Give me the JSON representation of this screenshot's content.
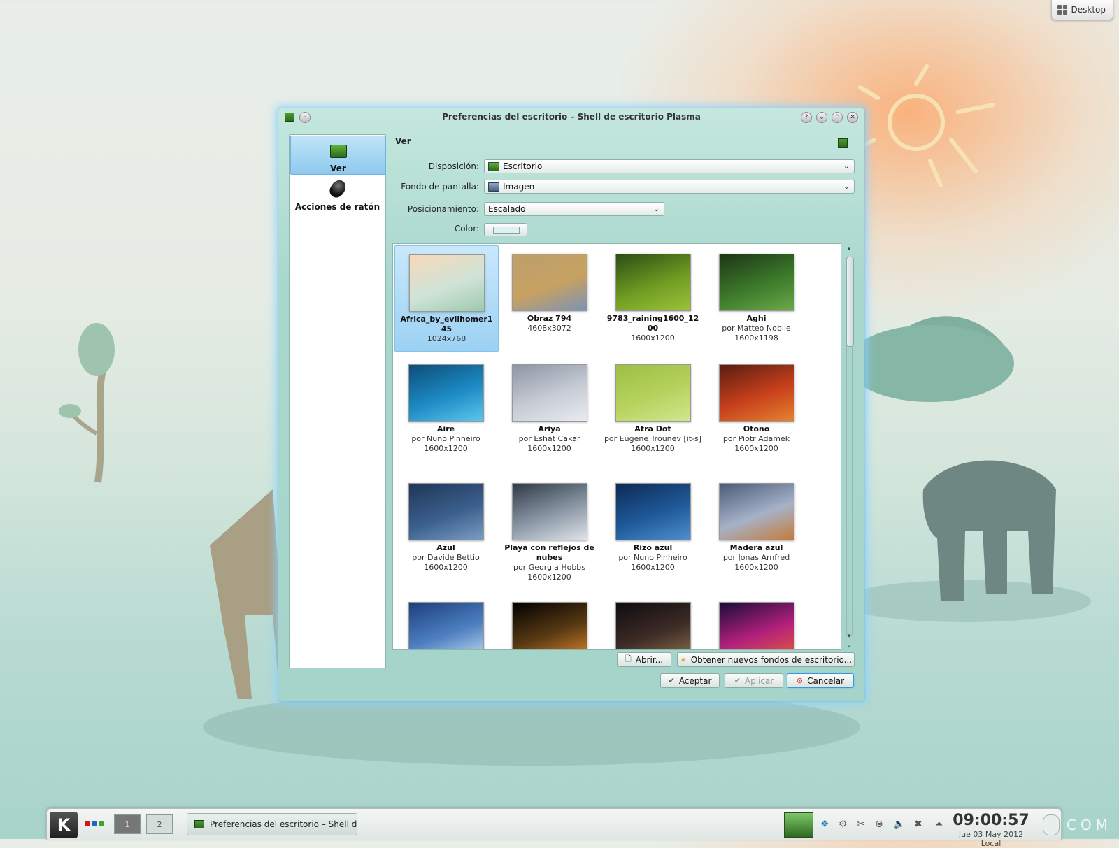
{
  "desktop": {
    "toolbox_label": "Desktop"
  },
  "dialog": {
    "title": "Preferencias del escritorio – Shell de escritorio Plasma",
    "sidebar": [
      {
        "label": "Ver",
        "icon": "display-icon",
        "selected": true
      },
      {
        "label": "Acciones de ratón",
        "icon": "mouse-icon",
        "selected": false
      }
    ],
    "section_title": "Ver",
    "form": {
      "layout_label": "Disposición:",
      "layout_value": "Escritorio",
      "wallpaper_label": "Fondo de pantalla:",
      "wallpaper_value": "Imagen",
      "positioning_label": "Posicionamiento:",
      "positioning_value": "Escalado",
      "color_label": "Color:",
      "color_value": "#dfeff3"
    },
    "wallpapers": [
      {
        "name": "Africa_by_evilhomer1 45",
        "author": "",
        "size": "1024x768",
        "selected": true,
        "colors": [
          "#f6d9b8",
          "#cfe3d7",
          "#9dc9ad"
        ]
      },
      {
        "name": "Obraz 794",
        "author": "",
        "size": "4608x3072",
        "colors": [
          "#bda06c",
          "#c7a162",
          "#7b93b4"
        ]
      },
      {
        "name": "9783_raining1600_12 00",
        "author": "",
        "size": "1600x1200",
        "colors": [
          "#2d4d13",
          "#6f9c22",
          "#9cc23b"
        ]
      },
      {
        "name": "Aghi",
        "author": "por Matteo Nobile",
        "size": "1600x1198",
        "colors": [
          "#1d3518",
          "#3d7a2a",
          "#6ca84b"
        ]
      },
      {
        "name": "Aire",
        "author": "por Nuno Pinheiro",
        "size": "1600x1200",
        "colors": [
          "#0c4d78",
          "#1d8bc4",
          "#5ac6ee"
        ]
      },
      {
        "name": "Ariya",
        "author": "por Eshat Cakar",
        "size": "1600x1200",
        "colors": [
          "#8d95a3",
          "#c7ccd5",
          "#e8ebf0"
        ]
      },
      {
        "name": "Atra Dot",
        "author": "por Eugene Trounev [it-s]",
        "size": "1600x1200",
        "colors": [
          "#9bbf43",
          "#b7d35e",
          "#d1e690"
        ]
      },
      {
        "name": "Otoño",
        "author": "por Piotr Adamek",
        "size": "1600x1200",
        "colors": [
          "#5a1d10",
          "#c8401c",
          "#e4832f"
        ]
      },
      {
        "name": "Azul",
        "author": "por Davide Bettio",
        "size": "1600x1200",
        "colors": [
          "#1f3658",
          "#3b5f8c",
          "#7a9cc4"
        ]
      },
      {
        "name": "Playa con reflejos de nubes",
        "author": "por Georgia Hobbs",
        "size": "1600x1200",
        "colors": [
          "#2f3a46",
          "#8b98a6",
          "#dfe3e8"
        ]
      },
      {
        "name": "Rizo azul",
        "author": "por Nuno Pinheiro",
        "size": "1600x1200",
        "colors": [
          "#0d2a55",
          "#1f5a9a",
          "#4f8fcf"
        ]
      },
      {
        "name": "Madera azul",
        "author": "por Jonas Arnfred",
        "size": "1600x1200",
        "colors": [
          "#4b5a78",
          "#a6b2c8",
          "#c47b3a"
        ]
      },
      {
        "name": "",
        "author": "",
        "size": "",
        "colors": [
          "#1c3f7c",
          "#4d7fc0",
          "#c2d8f0"
        ]
      },
      {
        "name": "",
        "author": "",
        "size": "",
        "colors": [
          "#000000",
          "#5a3a14",
          "#d9862a"
        ]
      },
      {
        "name": "",
        "author": "",
        "size": "",
        "colors": [
          "#0f0c10",
          "#3d2b26",
          "#8a6e4a"
        ]
      },
      {
        "name": "",
        "author": "",
        "size": "",
        "colors": [
          "#1a0c3a",
          "#b2207c",
          "#e55a3a"
        ]
      }
    ],
    "buttons": {
      "open": "Abrir...",
      "get_new": "Obtener nuevos fondos de escritorio...",
      "accept": "Aceptar",
      "apply": "Aplicar",
      "cancel": "Cancelar"
    }
  },
  "taskbar": {
    "pager": [
      "1",
      "2"
    ],
    "task_label": "Preferencias del escritorio – Shell de",
    "clock_time": "09:00:57",
    "clock_date": "Jue 03 May 2012 Local"
  },
  "watermark": "COM"
}
